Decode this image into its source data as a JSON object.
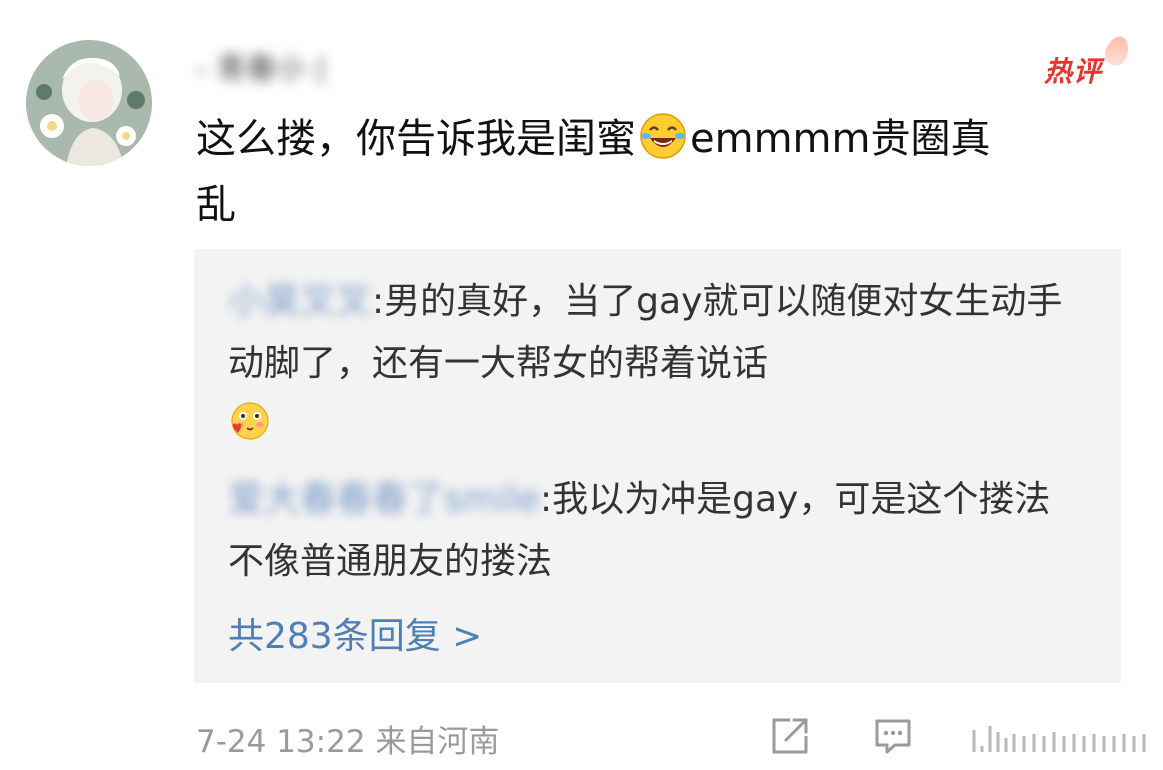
{
  "comment": {
    "username": "- 青春小 |",
    "badge": "热评",
    "text_line1_before_emoji": "这么搂，你告诉我是闺蜜",
    "text_line1_after_emoji": "emmmm贵圈真",
    "text_line2": "乱",
    "emoji_name": "laughing-crying-emoji"
  },
  "replies": [
    {
      "user": "小昊叉叉",
      "separator": ":",
      "text": "男的真好，当了gay就可以随便对女生动手动脚了，还有一大帮女的帮着说话",
      "emoji_name": "blush-heart-emoji"
    },
    {
      "user": "爱大春春春了smile",
      "separator": ":",
      "text": "我以为冲是gay，可是这个搂法不像普通朋友的搂法"
    }
  ],
  "more_replies_label": "共283条回复 >",
  "footer": {
    "time": "7-24 13:22",
    "source": "来自河南"
  },
  "colors": {
    "badge": "#e3362e",
    "link": "#4e7fb6",
    "reply_bg": "#f3f3f3",
    "meta": "#9a9a9a"
  }
}
